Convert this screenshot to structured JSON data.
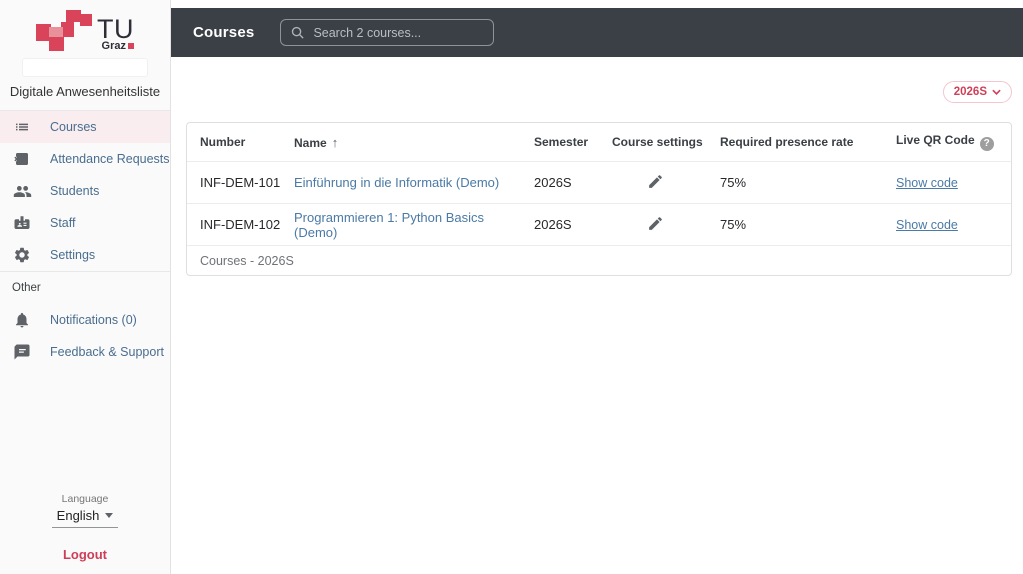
{
  "brand": {
    "logo_tu": "TU",
    "logo_graz": "Graz",
    "app_title": "Digitale Anwesenheitsliste"
  },
  "header": {
    "title": "Courses",
    "search_placeholder": "Search 2 courses..."
  },
  "sidebar": {
    "items": [
      {
        "label": "Courses",
        "icon": "list-icon",
        "active": true
      },
      {
        "label": "Attendance Requests",
        "icon": "cancel-presentation-icon",
        "active": false
      },
      {
        "label": "Students",
        "icon": "people-icon",
        "active": false
      },
      {
        "label": "Staff",
        "icon": "badge-icon",
        "active": false
      },
      {
        "label": "Settings",
        "icon": "gear-icon",
        "active": false
      }
    ],
    "other_label": "Other",
    "other_items": [
      {
        "label": "Notifications (0)",
        "icon": "bell-icon"
      },
      {
        "label": "Feedback & Support",
        "icon": "chat-icon"
      }
    ],
    "language_label": "Language",
    "language_value": "English",
    "logout_label": "Logout"
  },
  "filters": {
    "semester_button": "2026S"
  },
  "table": {
    "columns": [
      "Number",
      "Name",
      "Semester",
      "Course settings",
      "Required presence rate",
      "Live QR Code"
    ],
    "sort_column": "Name",
    "sort_indicator": "↑",
    "rows": [
      {
        "number": "INF-DEM-101",
        "name": "Einführung in die Informatik (Demo)",
        "semester": "2026S",
        "presence_rate": "75%",
        "qr_label": "Show code"
      },
      {
        "number": "INF-DEM-102",
        "name": "Programmieren 1: Python Basics (Demo)",
        "semester": "2026S",
        "presence_rate": "75%",
        "qr_label": "Show code"
      }
    ],
    "footer": "Courses - 2026S"
  },
  "colors": {
    "topbar_bg": "#3a4046",
    "accent_red": "#ce3e56",
    "logo_red": "#d9445a",
    "active_item_bg": "#f9edef",
    "sidebar_link": "#4a6d8f",
    "table_link": "#4a7aa5"
  }
}
